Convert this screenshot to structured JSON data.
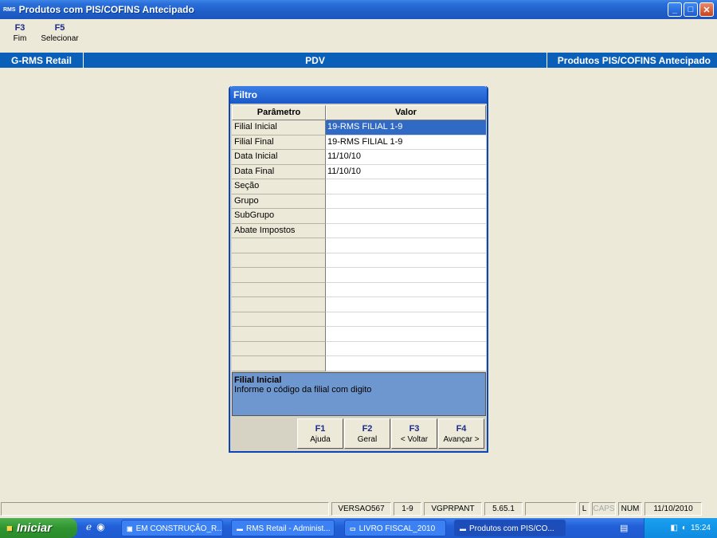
{
  "window": {
    "app_icon": "RMS",
    "title": "Produtos com PIS/COFINS Antecipado",
    "buttons": [
      "_",
      "□",
      "✕"
    ]
  },
  "toolbar": [
    {
      "key": "F3",
      "label": "Fim"
    },
    {
      "key": "F5",
      "label": "Selecionar"
    }
  ],
  "band": {
    "left": "G-RMS Retail",
    "center": "PDV",
    "right": "Produtos PIS/COFINS Antecipado"
  },
  "filter": {
    "title": "Filtro",
    "headers": [
      "Parâmetro",
      "Valor"
    ],
    "rows": [
      {
        "param": "Filial Inicial",
        "value": "19-RMS FILIAL 1-9"
      },
      {
        "param": "Filial Final",
        "value": "19-RMS FILIAL 1-9"
      },
      {
        "param": "Data Inicial",
        "value": "11/10/10"
      },
      {
        "param": "Data Final",
        "value": "11/10/10"
      },
      {
        "param": "Seção",
        "value": ""
      },
      {
        "param": "Grupo",
        "value": ""
      },
      {
        "param": "SubGrupo",
        "value": ""
      },
      {
        "param": "Abate Impostos",
        "value": ""
      },
      {
        "param": "",
        "value": ""
      },
      {
        "param": "",
        "value": ""
      },
      {
        "param": "",
        "value": ""
      },
      {
        "param": "",
        "value": ""
      },
      {
        "param": "",
        "value": ""
      },
      {
        "param": "",
        "value": ""
      },
      {
        "param": "",
        "value": ""
      },
      {
        "param": "",
        "value": ""
      },
      {
        "param": "",
        "value": ""
      }
    ],
    "info_title": "Filial Inicial",
    "info_text": "Informe o código da filial com digito",
    "buttons": [
      {
        "key": "F1",
        "label": "Ajuda"
      },
      {
        "key": "F2",
        "label": "Geral"
      },
      {
        "key": "F3",
        "label": "< Voltar"
      },
      {
        "key": "F4",
        "label": "Avançar >"
      }
    ]
  },
  "statusbar": {
    "version": "VERSAO567",
    "filial": "1-9",
    "program": "VGPRPANT",
    "build": "5.65.1",
    "l": "L",
    "caps": "CAPS",
    "num": "NUM",
    "date": "11/10/2010"
  },
  "taskbar": {
    "start": "Iniciar",
    "tasks": [
      "EM CONSTRUÇÃO_R...",
      "RMS Retail - Administ...",
      "LIVRO FISCAL_2010",
      "Produtos com PIS/CO..."
    ],
    "clock": "15:24"
  }
}
